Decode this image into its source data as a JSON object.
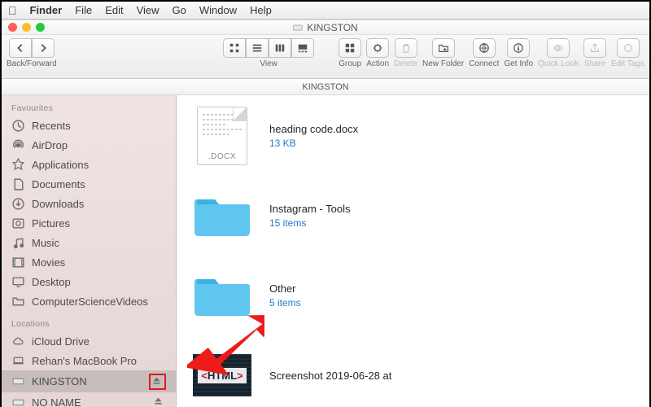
{
  "menubar": {
    "app": "Finder",
    "items": [
      "File",
      "Edit",
      "View",
      "Go",
      "Window",
      "Help"
    ]
  },
  "window": {
    "title": "KINGSTON",
    "pathbar": "KINGSTON"
  },
  "toolbar": {
    "back_forward": "Back/Forward",
    "view": "View",
    "group": "Group",
    "action": "Action",
    "delete": "Delete",
    "new_folder": "New Folder",
    "connect": "Connect",
    "get_info": "Get Info",
    "quick_look": "Quick Look",
    "share": "Share",
    "edit_tags": "Edit Tags"
  },
  "sidebar": {
    "favourites_h": "Favourites",
    "favourites": [
      {
        "label": "Recents",
        "icon": "recents"
      },
      {
        "label": "AirDrop",
        "icon": "airdrop"
      },
      {
        "label": "Applications",
        "icon": "applications"
      },
      {
        "label": "Documents",
        "icon": "documents"
      },
      {
        "label": "Downloads",
        "icon": "downloads"
      },
      {
        "label": "Pictures",
        "icon": "pictures"
      },
      {
        "label": "Music",
        "icon": "music"
      },
      {
        "label": "Movies",
        "icon": "movies"
      },
      {
        "label": "Desktop",
        "icon": "desktop"
      },
      {
        "label": "ComputerScienceVideos",
        "icon": "folder"
      }
    ],
    "locations_h": "Locations",
    "locations": [
      {
        "label": "iCloud Drive",
        "icon": "icloud",
        "eject": false
      },
      {
        "label": "Rehan's MacBook Pro",
        "icon": "laptop",
        "eject": false
      },
      {
        "label": "KINGSTON",
        "icon": "disk",
        "eject": true,
        "selected": true,
        "highlight_eject": true
      },
      {
        "label": "NO NAME",
        "icon": "disk",
        "eject": true
      }
    ]
  },
  "files": [
    {
      "name": "heading code.docx",
      "sub": "13 KB",
      "kind": "docx"
    },
    {
      "name": "Instagram - Tools",
      "sub": "15 items",
      "kind": "folder"
    },
    {
      "name": "Other",
      "sub": "5 items",
      "kind": "folder"
    },
    {
      "name": "Screenshot 2019-06-28 at",
      "sub": "",
      "kind": "html"
    }
  ]
}
